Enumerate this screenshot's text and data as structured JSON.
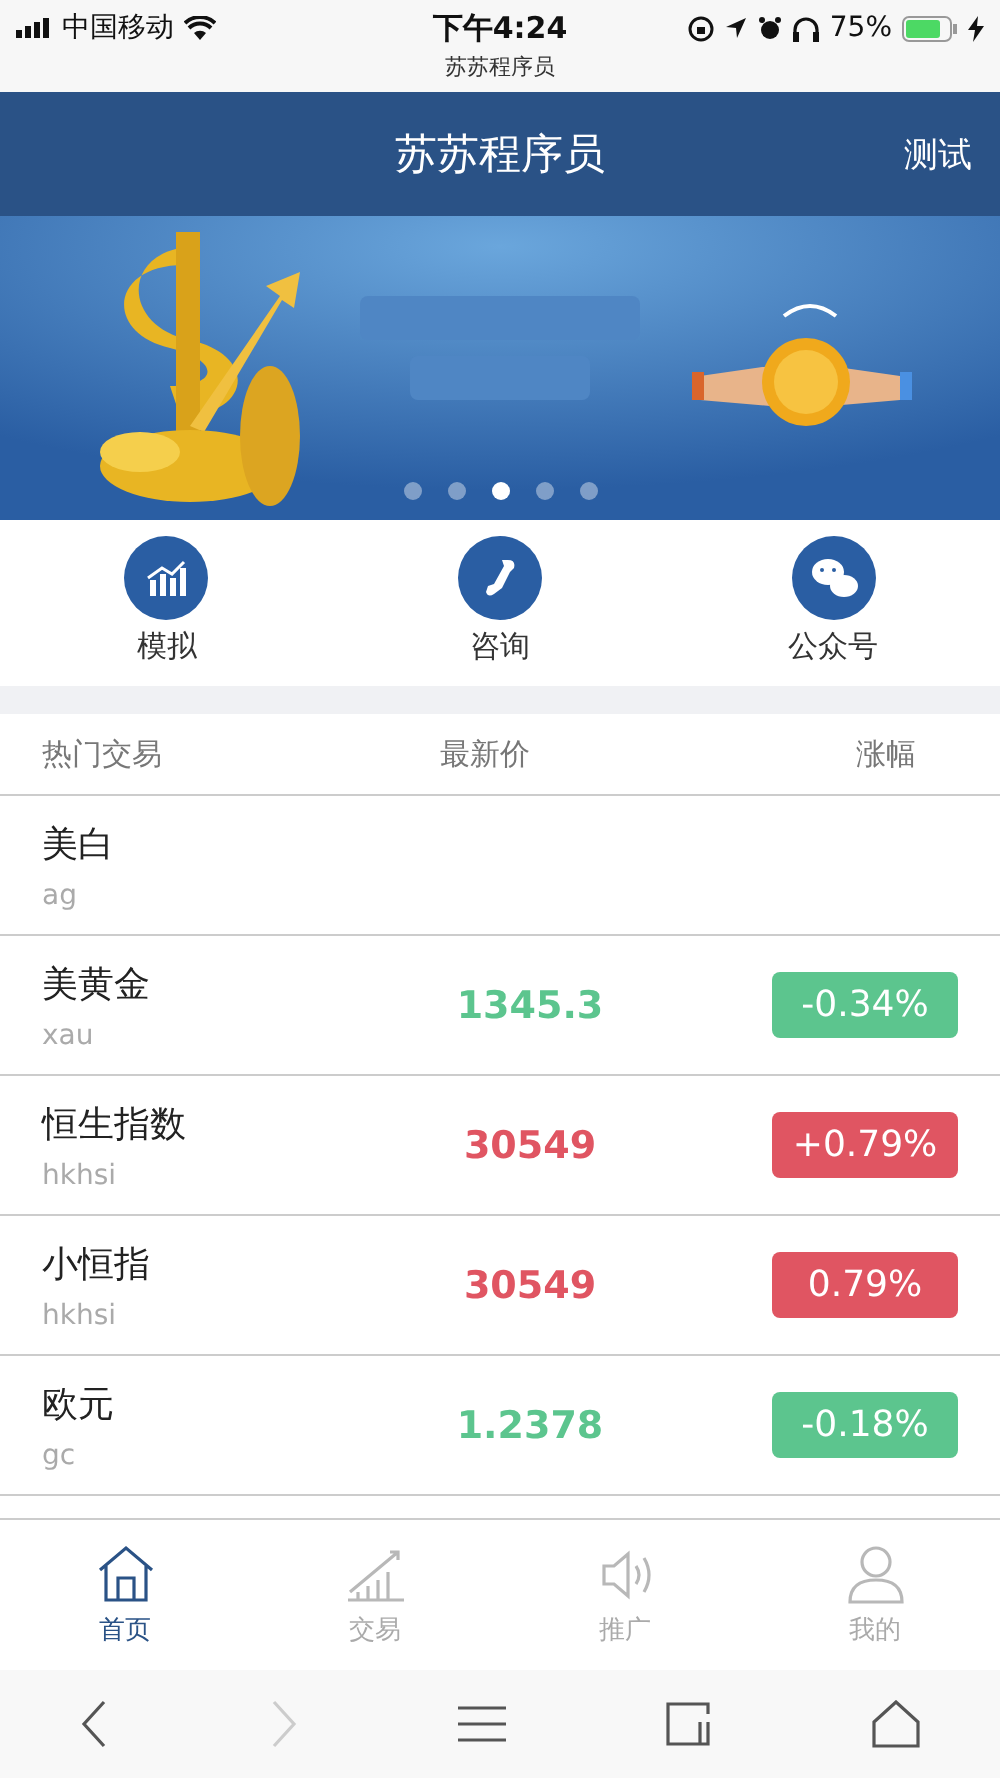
{
  "status_bar": {
    "carrier": "中国移动",
    "time": "下午4:24",
    "battery": "75%",
    "site": "苏苏程序员"
  },
  "header": {
    "title": "苏苏程序员",
    "action": "测试"
  },
  "banner": {
    "kind": "picture",
    "dots": [
      {
        "selected": false
      },
      {
        "selected": false
      },
      {
        "selected": true
      },
      {
        "selected": false
      },
      {
        "selected": false
      }
    ]
  },
  "shortcuts": [
    {
      "label": "模拟",
      "kind": "chart"
    },
    {
      "label": "咨询",
      "kind": "phone"
    },
    {
      "label": "公众号",
      "kind": "chat"
    }
  ],
  "table": {
    "columns": [
      "热门交易",
      "最新价",
      "涨幅"
    ],
    "rows": [
      {
        "name": "美白",
        "code": "ag"
      },
      {
        "name": "美黄金",
        "code": "xau",
        "price": "1345.3",
        "change": "-0.34%",
        "color": "#5cc58e"
      },
      {
        "name": "恒生指数",
        "code": "hkhsi",
        "price": "30549",
        "change": "+0.79%",
        "color": "#e05562"
      },
      {
        "name": "小恒指",
        "code": "hkhsi",
        "price": "30549",
        "change": "0.79%",
        "color": "#e05562"
      },
      {
        "name": "欧元",
        "code": "gc",
        "price": "1.2378",
        "change": "-0.18%",
        "color": "#5cc58e"
      }
    ]
  },
  "tab_bar": [
    {
      "label": "首页",
      "kind": "home",
      "selected": true
    },
    {
      "label": "交易",
      "kind": "chart",
      "selected": false
    },
    {
      "label": "推广",
      "kind": "speaker",
      "selected": false
    },
    {
      "label": "我的",
      "kind": "person",
      "selected": false
    }
  ],
  "browser_bar": {
    "forward_disabled": true
  }
}
